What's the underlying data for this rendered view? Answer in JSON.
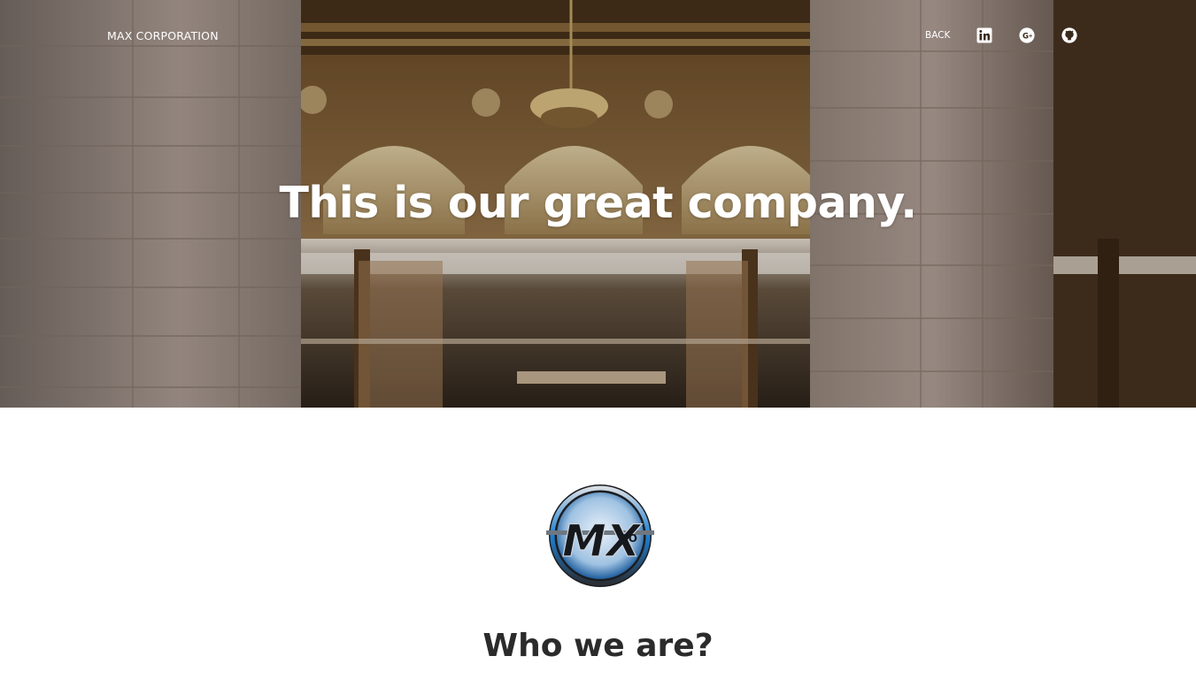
{
  "navbar": {
    "brand": "MAX CORPORATION",
    "back_label": "BACK",
    "icons": [
      "linkedin-icon",
      "google-plus-icon",
      "github-icon"
    ]
  },
  "hero": {
    "title": "This is our great company."
  },
  "about": {
    "logo_text": "MX",
    "logo_subtext": "CO",
    "title": "Who we are?"
  },
  "colors": {
    "hero_overlay": "#3a2a1c",
    "nav_text": "#ffffff",
    "heading_dark": "#2b2b2b",
    "logo_ring": "#1e7fd1"
  }
}
